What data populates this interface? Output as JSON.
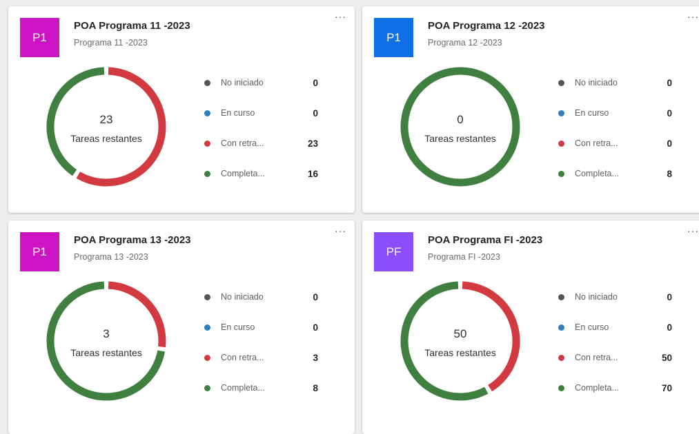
{
  "legend_colors": {
    "no_iniciado": "#555555",
    "en_curso": "#2f80c2",
    "con_retraso": "#d23a3f",
    "completado": "#3f7f3f"
  },
  "cards": [
    {
      "avatar": "P1",
      "avatar_color": "#cc14c4",
      "title": "POA Programa 11 -2023",
      "subtitle": "Programa 11 -2023",
      "more": "···",
      "center_count": "23",
      "center_label": "Tareas restantes",
      "legend": [
        {
          "label": "No iniciado",
          "value": "0"
        },
        {
          "label": "En curso",
          "value": "0"
        },
        {
          "label": "Con retra...",
          "value": "23"
        },
        {
          "label": "Completa...",
          "value": "16"
        }
      ]
    },
    {
      "avatar": "P1",
      "avatar_color": "#0f6fe6",
      "title": "POA Programa 12 -2023",
      "subtitle": "Programa 12 -2023",
      "more": "···",
      "center_count": "0",
      "center_label": "Tareas restantes",
      "legend": [
        {
          "label": "No iniciado",
          "value": "0"
        },
        {
          "label": "En curso",
          "value": "0"
        },
        {
          "label": "Con retra...",
          "value": "0"
        },
        {
          "label": "Completa...",
          "value": "8"
        }
      ]
    },
    {
      "avatar": "P1",
      "avatar_color": "#cc14c4",
      "title": "POA Programa 13 -2023",
      "subtitle": "Programa 13 -2023",
      "more": "···",
      "center_count": "3",
      "center_label": "Tareas restantes",
      "legend": [
        {
          "label": "No iniciado",
          "value": "0"
        },
        {
          "label": "En curso",
          "value": "0"
        },
        {
          "label": "Con retra...",
          "value": "3"
        },
        {
          "label": "Completa...",
          "value": "8"
        }
      ]
    },
    {
      "avatar": "PF",
      "avatar_color": "#8a4dfa",
      "title": "POA Programa FI -2023",
      "subtitle": "Programa FI -2023",
      "more": "···",
      "center_count": "50",
      "center_label": "Tareas restantes",
      "legend": [
        {
          "label": "No iniciado",
          "value": "0"
        },
        {
          "label": "En curso",
          "value": "0"
        },
        {
          "label": "Con retra...",
          "value": "50"
        },
        {
          "label": "Completa...",
          "value": "70"
        }
      ]
    }
  ]
}
